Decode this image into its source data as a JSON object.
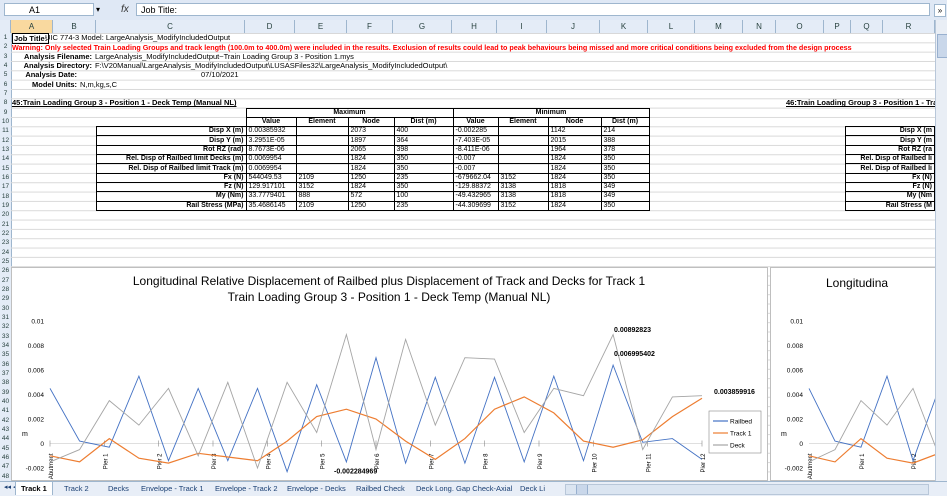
{
  "formula_bar": {
    "name_box": "A1",
    "fx": "fx",
    "content": "Job Title:"
  },
  "columns": [
    "A",
    "B",
    "C",
    "D",
    "E",
    "F",
    "G",
    "H",
    "I",
    "J",
    "K",
    "L",
    "M",
    "N",
    "O",
    "P",
    "Q",
    "R"
  ],
  "rows": [
    "1",
    "2",
    "3",
    "4",
    "5",
    "6",
    "7",
    "8",
    "9",
    "10",
    "11",
    "12",
    "13",
    "14",
    "15",
    "16",
    "17",
    "18",
    "19",
    "20",
    "21",
    "22",
    "23",
    "24",
    "25",
    "26",
    "27",
    "28",
    "29",
    "30",
    "31",
    "32",
    "33",
    "34",
    "35",
    "36",
    "37",
    "38",
    "39",
    "40",
    "41",
    "42",
    "43",
    "44",
    "45",
    "46",
    "47",
    "48"
  ],
  "sheet": {
    "job_title_label": "Job Title:",
    "job_title_value": "UIC 774-3 Model: LargeAnalysis_ModifyIncludedOutput",
    "warning": "Warning: Only selected Train Loading Groups and track length (100.0m to 400.0m) were included in the results. Exclusion of results could lead to peak behaviours being missed and more critical conditions being excluded from the design process",
    "analysis_filename_label": "Analysis Filename:",
    "analysis_filename": "LargeAnalysis_ModifyIncludedOutput~Train Loading Group 3 - Position 1.mys",
    "analysis_directory_label": "Analysis Directory:",
    "analysis_directory": "F:\\V20Manual\\LargeAnalysis_ModifyIncludedOutput\\LUSASFiles32\\LargeAnalysis_ModifyIncludedOutput\\",
    "analysis_date_label": "Analysis Date:",
    "analysis_date": "07/10/2021",
    "model_units_label": "Model Units:",
    "model_units": "N,m,kg,s,C",
    "section_title": "45:Train Loading Group 3 - Position 1 - Deck Temp (Manual NL)",
    "section_title_right": "46:Train Loading Group 3 - Position 1 - Train L"
  },
  "table": {
    "group_max": "Maximum",
    "group_min": "Minimum",
    "headers": [
      "Value",
      "Element",
      "Node",
      "Dist (m)",
      "Value",
      "Element",
      "Node",
      "Dist (m)"
    ],
    "rows": [
      {
        "label": "Disp X (m)",
        "cells": [
          "0.00385932",
          "",
          "2073",
          "400",
          "-0.002285",
          "",
          "1142",
          "214"
        ]
      },
      {
        "label": "Disp Y (m)",
        "cells": [
          "3.2951E-05",
          "",
          "1897",
          "364",
          "-7.403E-05",
          "",
          "2015",
          "388"
        ]
      },
      {
        "label": "Rot RZ (rad)",
        "cells": [
          "8.7673E-06",
          "",
          "2065",
          "398",
          "-8.411E-06",
          "",
          "1964",
          "378"
        ]
      },
      {
        "label": "Rel. Disp of Railbed limit Decks (m)",
        "cells": [
          "0.0069954",
          "",
          "1824",
          "350",
          "-0.007",
          "",
          "1824",
          "350"
        ]
      },
      {
        "label": "Rel. Disp of Railbed limit Track (m)",
        "cells": [
          "0.0069954",
          "",
          "1824",
          "350",
          "-0.007",
          "",
          "1824",
          "350"
        ]
      },
      {
        "label": "Fx (N)",
        "cells": [
          "544049.53",
          "2109",
          "1250",
          "235",
          "-679662.04",
          "3152",
          "1824",
          "350"
        ]
      },
      {
        "label": "Fz (N)",
        "cells": [
          "129.917101",
          "3152",
          "1824",
          "350",
          "-129.88372",
          "3138",
          "1818",
          "349"
        ]
      },
      {
        "label": "My (Nm)",
        "cells": [
          "33.7779401",
          "888",
          "572",
          "100",
          "-49.432965",
          "3138",
          "1818",
          "349"
        ]
      },
      {
        "label": "Rail Stress (MPa)",
        "cells": [
          "35.4686145",
          "2109",
          "1250",
          "235",
          "-44.309699",
          "3152",
          "1824",
          "350"
        ]
      }
    ],
    "right_labels": [
      "Disp X (m",
      "Disp Y (m",
      "Rot RZ (ra",
      "Rel. Disp of Railbed li",
      "Rel. Disp of Railbed li",
      "Fx (N)",
      "Fz (N)",
      "My (Nm",
      "Rail Stress (M"
    ]
  },
  "chart_data": [
    {
      "type": "line",
      "title": "Longitudinal Relative Displacement of Railbed plus Displacement of Track and Decks for Track 1",
      "subtitle": "Train Loading Group 3 - Position 1 - Deck Temp (Manual NL)",
      "ylabel": "m",
      "ylim": [
        -0.002,
        0.01
      ],
      "yticks": [
        "0.01",
        "0.008",
        "0.006",
        "0.004",
        "0.002",
        "0",
        "-0.002"
      ],
      "pier_labels": [
        "Abutment",
        "Pier 1",
        "Pier 2",
        "Pier 3",
        "Pier 4",
        "Pier 5",
        "Pier 6",
        "Pier 7",
        "Pier 8",
        "Pier 9",
        "Pier 10",
        "Pier 11",
        "Pier 12"
      ],
      "series": [
        {
          "name": "Railbed",
          "color": "#4472c4",
          "values": [
            0.0045,
            0.0002,
            -0.0003,
            0.0055,
            -0.0014,
            0.0045,
            -0.0014,
            0.0045,
            -0.0023,
            0.0048,
            -0.0015,
            0.007,
            -0.0016,
            0.0054,
            -0.0016,
            0.0054,
            -0.0015,
            0.0055,
            -0.0014,
            0.0064,
            0.0001,
            0.0004,
            -0.0013
          ]
        },
        {
          "name": "Track 1",
          "color": "#ed7d31",
          "values": [
            -0.001,
            -0.0015,
            0.0004,
            -0.0012,
            -0.0016,
            -0.0008,
            -0.0011,
            -0.0014,
            0.0002,
            0.0022,
            0.0028,
            0.002,
            0.0002,
            -0.0013,
            0.0004,
            0.0028,
            0.0038,
            0.0025,
            0.0002,
            -0.0003,
            0.0003,
            0.0022,
            0.0037
          ]
        },
        {
          "name": "Deck",
          "color": "#a5a5a5",
          "values": [
            -0.0015,
            -0.0005,
            0.0035,
            0.0015,
            0.0045,
            -0.001,
            0.005,
            -0.002,
            0.005,
            0.0009,
            0.0089,
            -0.0005,
            0.0085,
            0.0015,
            0.007,
            0.0069,
            0.0009,
            0.0045,
            0.0039,
            0.0089,
            -0.0005,
            0.0038,
            0.0039
          ]
        }
      ],
      "annotations": [
        "0.00892823",
        "0.006995402",
        "0.003859916",
        "-0.002284969"
      ]
    }
  ],
  "right_chart": {
    "title": "Longitudina",
    "yticks": [
      "0.01",
      "0.008",
      "0.006",
      "0.004",
      "0.002",
      "0",
      "-0.002"
    ],
    "ylabel": "m",
    "pier_labels": [
      "Abutment",
      "Pier 1",
      "Pier 2"
    ]
  },
  "tabs": [
    "Track 1",
    "Track 2",
    "Decks",
    "Envelope - Track 1",
    "Envelope - Track 2",
    "Envelope - Decks",
    "Railbed Check",
    "Deck Long. Gap Check-Axial",
    "Deck Li"
  ]
}
